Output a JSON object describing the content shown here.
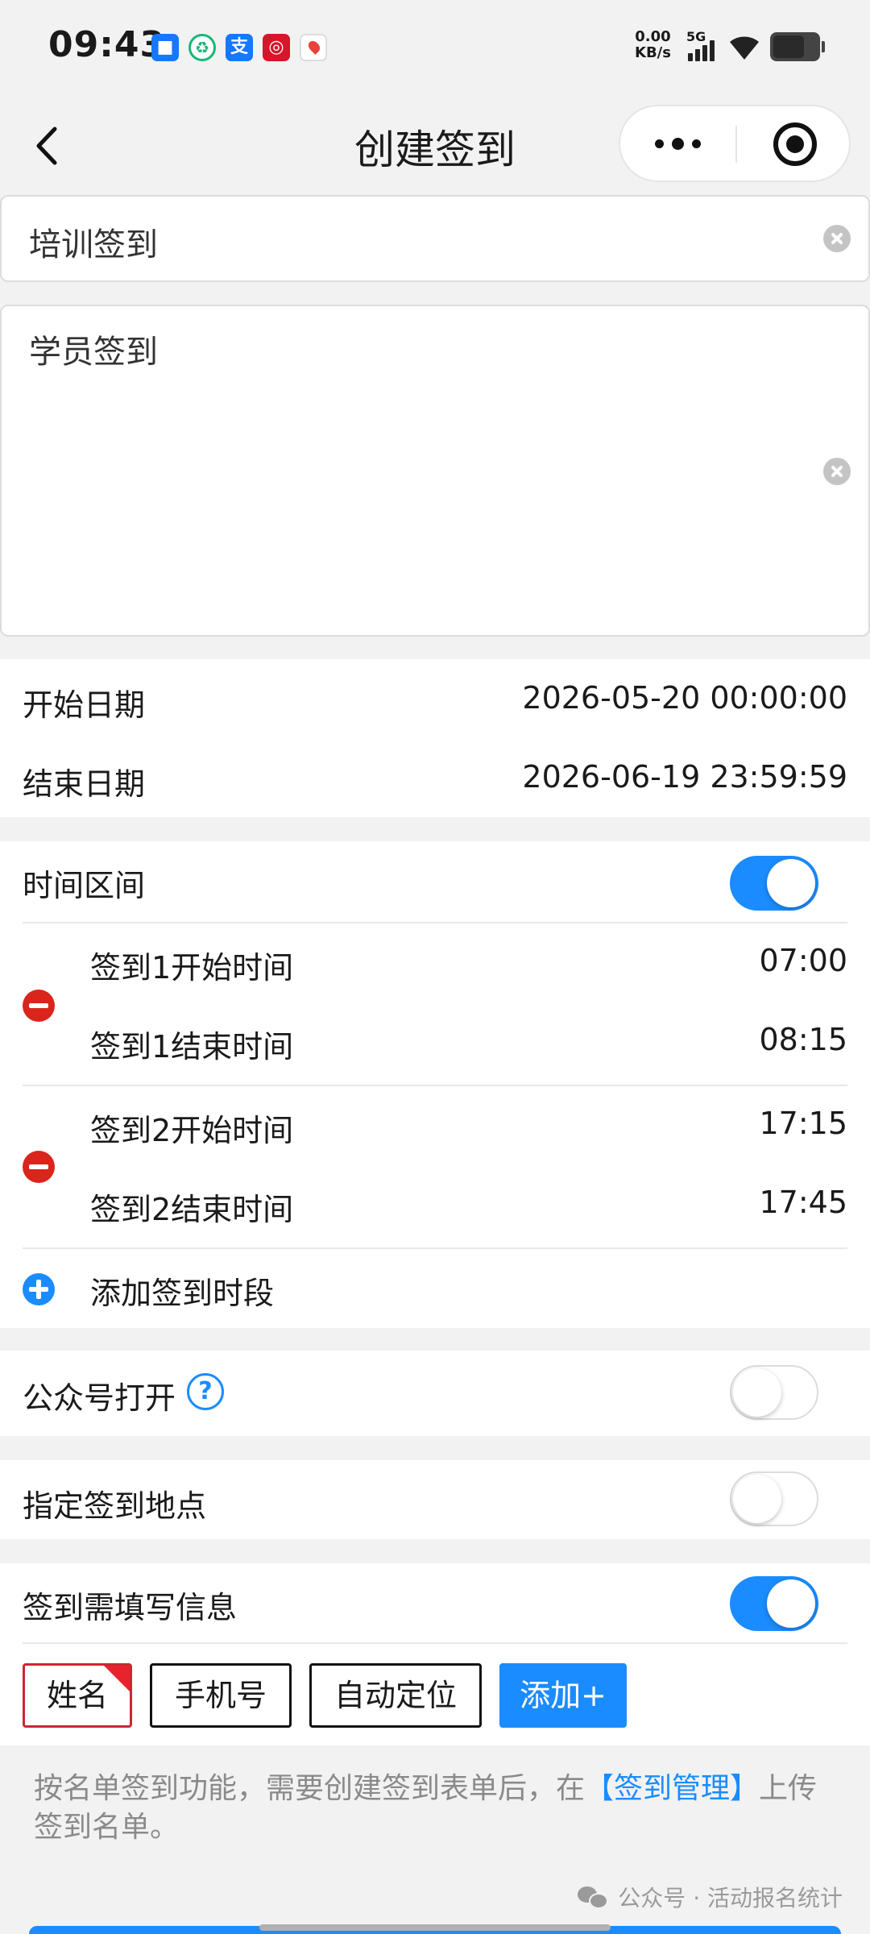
{
  "status_bar": {
    "time": "09:43",
    "net_speed_value": "0.00",
    "net_speed_unit": "KB/s",
    "network": "5G",
    "notification_icons": [
      "app-icon",
      "recycle-icon",
      "alipay-icon",
      "bank-icon",
      "map-icon"
    ]
  },
  "nav": {
    "title": "创建签到",
    "back_icon": "chevron-left-icon",
    "more_icon": "more-dots-icon",
    "close_icon": "miniprogram-close-icon"
  },
  "form": {
    "title_value": "培训签到",
    "description_value": "学员签到"
  },
  "dates": {
    "start_label": "开始日期",
    "start_value": "2026-05-20 00:00:00",
    "end_label": "结束日期",
    "end_value": "2026-06-19 23:59:59"
  },
  "time_range": {
    "label": "时间区间",
    "enabled": true,
    "slots": [
      {
        "start_label": "签到1开始时间",
        "start_value": "07:00",
        "end_label": "签到1结束时间",
        "end_value": "08:15"
      },
      {
        "start_label": "签到2开始时间",
        "start_value": "17:15",
        "end_label": "签到2结束时间",
        "end_value": "17:45"
      }
    ],
    "add_label": "添加签到时段"
  },
  "official_account": {
    "label": "公众号打开",
    "help_glyph": "?",
    "enabled": false
  },
  "location": {
    "label": "指定签到地点",
    "enabled": false
  },
  "info": {
    "label": "签到需填写信息",
    "enabled": true,
    "fields": [
      "姓名",
      "手机号",
      "自动定位"
    ],
    "add_label": "添加+"
  },
  "note": {
    "text_before": "按名单签到功能，需要创建签到表单后，在",
    "link": "【签到管理】",
    "text_after": "上传签到名单。"
  },
  "watermark": "公众号 · 活动报名统计",
  "colors": {
    "accent": "#1a8cff",
    "danger": "#d9251c",
    "background": "#f2f2f2",
    "selected_chip_border": "#c82832"
  }
}
